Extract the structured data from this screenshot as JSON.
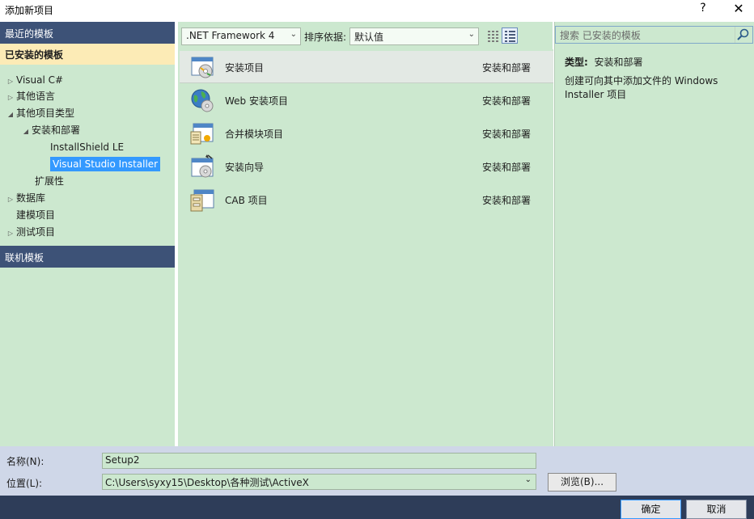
{
  "window": {
    "title": "添加新项目",
    "help_glyph": "?",
    "close_glyph": "✕"
  },
  "left_pane": {
    "recent_templates": "最近的模板",
    "installed_templates": "已安装的模板",
    "tree": [
      {
        "label": "Visual C#",
        "arrow": "▷",
        "level": 0
      },
      {
        "label": "其他语言",
        "arrow": "▷",
        "level": 0
      },
      {
        "label": "其他项目类型",
        "arrow": "◢",
        "level": 0
      },
      {
        "label": "安装和部署",
        "arrow": "◢",
        "level": 1
      },
      {
        "label": "InstallShield LE",
        "arrow": "",
        "level": 2
      },
      {
        "label": "Visual Studio Installer",
        "arrow": "",
        "level": 2,
        "selected": true
      },
      {
        "label": "扩展性",
        "arrow": "",
        "level": 1
      },
      {
        "label": "数据库",
        "arrow": "▷",
        "level": 0
      },
      {
        "label": "建模项目",
        "arrow": "",
        "level": 0
      },
      {
        "label": "测试项目",
        "arrow": "▷",
        "level": 0
      }
    ],
    "online_templates": "联机模板"
  },
  "toolbar": {
    "framework": ".NET Framework 4",
    "sort_label": "排序依据:",
    "sort_value": "默认值"
  },
  "templates": [
    {
      "name": "安装项目",
      "category": "安装和部署",
      "icon": "setup-project-icon"
    },
    {
      "name": "Web 安装项目",
      "category": "安装和部署",
      "icon": "web-setup-project-icon"
    },
    {
      "name": "合并模块项目",
      "category": "安装和部署",
      "icon": "merge-module-project-icon"
    },
    {
      "name": "安装向导",
      "category": "安装和部署",
      "icon": "setup-wizard-icon"
    },
    {
      "name": "CAB 项目",
      "category": "安装和部署",
      "icon": "cab-project-icon"
    }
  ],
  "details": {
    "search_placeholder": "搜索 已安装的模板",
    "type_label": "类型:",
    "type_value": "安装和部署",
    "description": "创建可向其中添加文件的 Windows Installer 项目"
  },
  "form": {
    "name_label": "名称(N):",
    "name_value": "Setup2",
    "location_label": "位置(L):",
    "location_value": "C:\\Users\\syxy15\\Desktop\\各种测试\\ActiveX",
    "browse_label": "浏览(B)..."
  },
  "buttons": {
    "ok": "确定",
    "cancel": "取消"
  },
  "colors": {
    "pane_bg": "#cce8cf",
    "header_dark": "#3d5277",
    "selection_blue": "#3399ff",
    "installed_highlight": "#fcebb6"
  }
}
